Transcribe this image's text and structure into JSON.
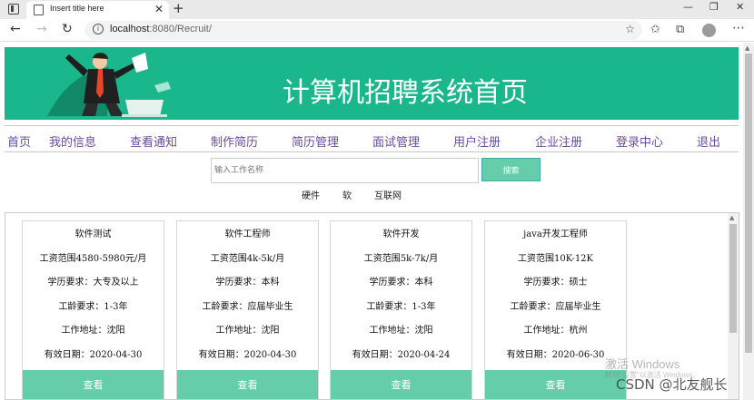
{
  "browser": {
    "tab_title": "Insert title here",
    "tab_close": "✕",
    "new_tab": "+",
    "url_host": "localhost",
    "url_path": ":8080/Recruit/",
    "window_controls": [
      "—",
      "❐",
      "✕"
    ]
  },
  "banner": {
    "title": "计算机招聘系统首页",
    "bg_color": "#1bb78c"
  },
  "nav": [
    "首页",
    "我的信息",
    "查看通知",
    "制作简历",
    "简历管理",
    "面试管理",
    "用户注册",
    "企业注册",
    "登录中心",
    "退出"
  ],
  "search": {
    "placeholder": "输入工作名称",
    "button": "搜索"
  },
  "categories": [
    "硬件",
    "软",
    "互联网"
  ],
  "jobs": [
    {
      "title": "软件测试",
      "salary": "工资范围4580-5980元/月",
      "education": "学历要求：大专及以上",
      "experience": "工龄要求：1-3年",
      "location": "工作地址：沈阳",
      "expiry": "有效日期：2020-04-30",
      "button": "查看"
    },
    {
      "title": "软件工程师",
      "salary": "工资范围4k-5k/月",
      "education": "学历要求：本科",
      "experience": "工龄要求：应届毕业生",
      "location": "工作地址：沈阳",
      "expiry": "有效日期：2020-04-30",
      "button": "查看"
    },
    {
      "title": "软件开发",
      "salary": "工资范围5k-7k/月",
      "education": "学历要求：本科",
      "experience": "工龄要求：1-3年",
      "location": "工作地址：沈阳",
      "expiry": "有效日期：2020-04-24",
      "button": "查看"
    },
    {
      "title": "java开发工程师",
      "salary": "工资范围10K-12K",
      "education": "学历要求：硕士",
      "experience": "工龄要求：应届毕业生",
      "location": "工作地址：杭州",
      "expiry": "有效日期：2020-06-30",
      "button": "查看"
    }
  ],
  "watermark": {
    "activate": "激活 Windows",
    "activate_sub": "转到\"设置\"以激活 Windows。",
    "csdn": "CSDN @北友舰长"
  },
  "accent_color": "#66cdaa"
}
